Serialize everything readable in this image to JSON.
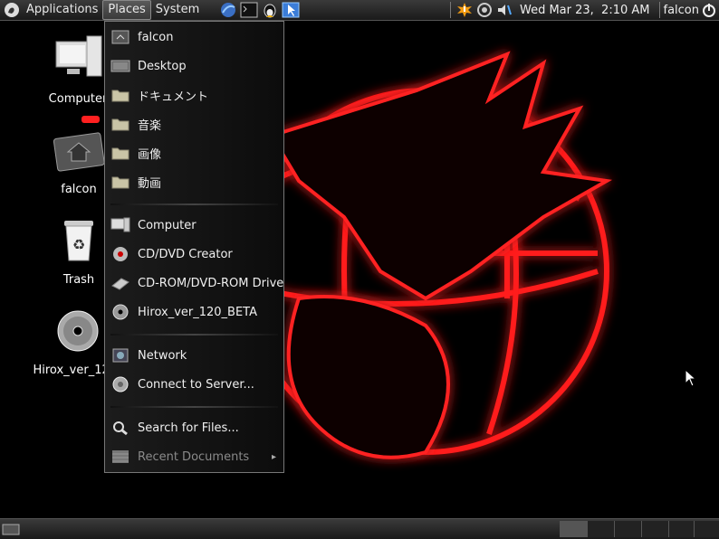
{
  "top_panel": {
    "menus": [
      "Applications",
      "Places",
      "System"
    ],
    "clock": "Wed Mar 23,  2:10 AM",
    "user": "falcon",
    "launchers": [
      "browser-icon",
      "terminal-icon",
      "tux-icon",
      "pointer-icon"
    ],
    "tray": [
      "update-icon",
      "network-icon",
      "volume-icon"
    ]
  },
  "desktop_icons": [
    {
      "label": "Computer",
      "icon": "computer-icon"
    },
    {
      "label": "falcon",
      "icon": "home-folder-icon"
    },
    {
      "label": "Trash",
      "icon": "trash-icon"
    },
    {
      "label": "Hirox_ver_120_",
      "icon": "cd-icon"
    }
  ],
  "places_menu": {
    "items": [
      {
        "label": "falcon",
        "icon": "home-folder-icon"
      },
      {
        "label": "Desktop",
        "icon": "desktop-folder-icon"
      },
      {
        "label": "ドキュメント",
        "icon": "folder-icon"
      },
      {
        "label": "音楽",
        "icon": "folder-icon"
      },
      {
        "label": "画像",
        "icon": "folder-icon"
      },
      {
        "label": "動画",
        "icon": "folder-icon"
      },
      {
        "label": "Computer",
        "icon": "computer-icon"
      },
      {
        "label": "CD/DVD Creator",
        "icon": "cd-burner-icon"
      },
      {
        "label": "CD-ROM/DVD-ROM Drive",
        "icon": "drive-icon"
      },
      {
        "label": "Hirox_ver_120_BETA",
        "icon": "cd-icon"
      },
      {
        "label": "Network",
        "icon": "network-icon"
      },
      {
        "label": "Connect to Server...",
        "icon": "server-icon"
      },
      {
        "label": "Search for Files...",
        "icon": "search-icon"
      },
      {
        "label": "Recent Documents",
        "icon": "recent-documents-icon",
        "disabled": true,
        "submenu": true
      }
    ]
  },
  "colors": {
    "accent_red": "#e00000",
    "panel": "#2a2a2a"
  }
}
